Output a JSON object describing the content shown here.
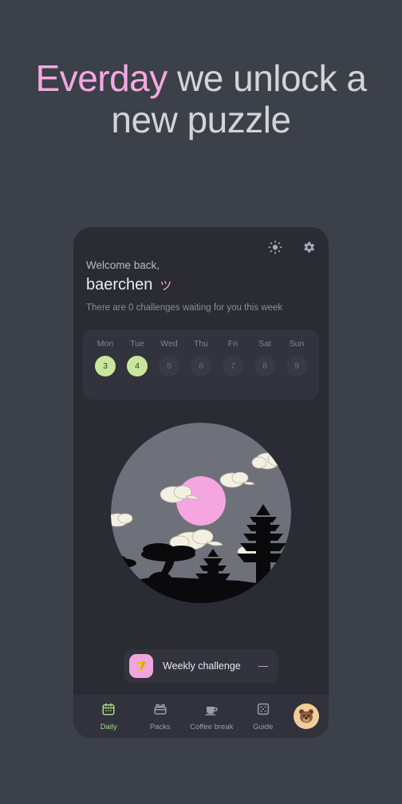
{
  "headline": {
    "accent_word": "Everday",
    "rest": " we unlock a new puzzle",
    "accent_color": "#f5a9e0",
    "text_color": "#d2d4d7"
  },
  "card": {
    "top_icons": [
      {
        "name": "brightness-icon",
        "label": "Brightness"
      },
      {
        "name": "settings-icon",
        "label": "Settings"
      }
    ],
    "greeting": {
      "welcome": "Welcome back,",
      "username": "baerchen",
      "kaomoji": "ツ",
      "challenge_note": "There are 0 challenges waiting for you this week"
    },
    "week": {
      "days": [
        {
          "name": "Mon",
          "number": "3",
          "active": true
        },
        {
          "name": "Tue",
          "number": "4",
          "active": true
        },
        {
          "name": "Wed",
          "number": "5",
          "active": false
        },
        {
          "name": "Thu",
          "number": "6",
          "active": false
        },
        {
          "name": "Fri",
          "number": "7",
          "active": false
        },
        {
          "name": "Sat",
          "number": "8",
          "active": false
        },
        {
          "name": "Sun",
          "number": "9",
          "active": false
        }
      ],
      "active_color": "#c9e79c",
      "inactive_color": "#393a44"
    },
    "illustration": {
      "name": "japanese-night-scene",
      "sky_color": "#6e7179",
      "moon_color": "#f5a5e0",
      "cloud_color": "#f3f0e2",
      "silhouette_color": "#0a0a0c"
    },
    "weekly_challenge": {
      "icon": "trophy-icon",
      "tile_color": "#f0a6dc",
      "label": "Weekly challenge",
      "value": "—"
    },
    "nav": {
      "items": [
        {
          "icon": "calendar-icon",
          "label": "Daily",
          "active": true
        },
        {
          "icon": "packs-icon",
          "label": "Packs",
          "active": false
        },
        {
          "icon": "coffee-cup-icon",
          "label": "Coffee break",
          "active": false
        },
        {
          "icon": "dice-icon",
          "label": "Guide",
          "active": false
        }
      ],
      "avatar": {
        "name": "bear-avatar",
        "bg": "#f2cd9a"
      },
      "active_color": "#a9d87a"
    }
  }
}
